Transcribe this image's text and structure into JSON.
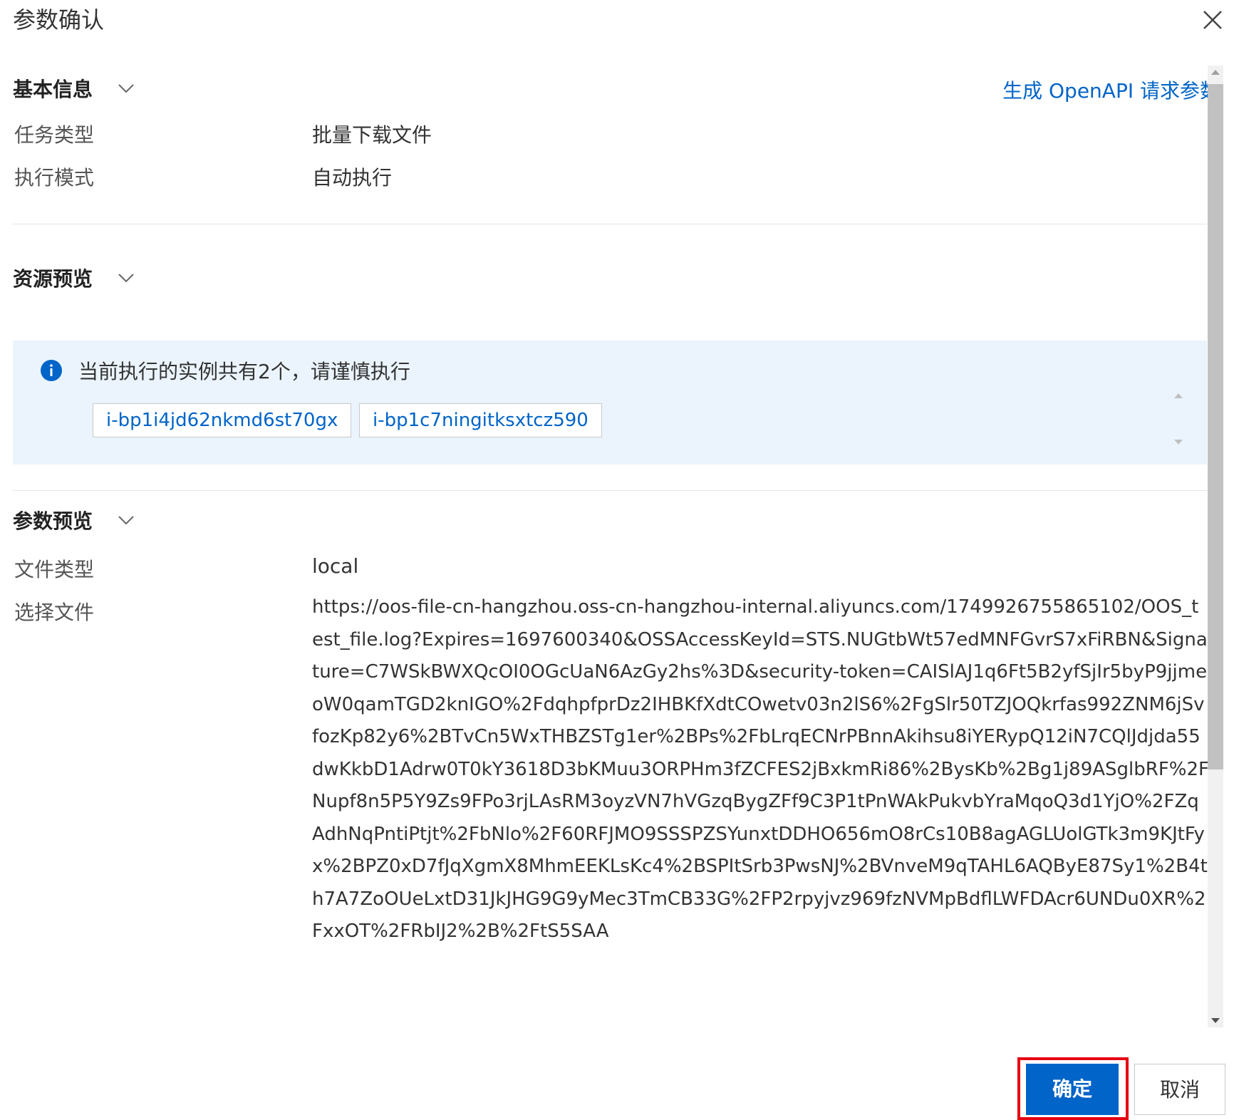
{
  "dialog": {
    "title": "参数确认",
    "close_icon": "close-icon"
  },
  "openapi_link": "生成 OpenAPI 请求参数",
  "basic_info": {
    "title": "基本信息",
    "rows": [
      {
        "label": "任务类型",
        "value": "批量下载文件"
      },
      {
        "label": "执行模式",
        "value": "自动执行"
      }
    ]
  },
  "resource_preview": {
    "title": "资源预览",
    "notice": "当前执行的实例共有2个，请谨慎执行",
    "instances": [
      "i-bp1i4jd62nkmd6st70gx",
      "i-bp1c7ningitksxtcz590"
    ]
  },
  "param_preview": {
    "title": "参数预览",
    "file_type_label": "文件类型",
    "file_type_value": "local",
    "select_file_label": "选择文件",
    "select_file_value": "https://oos-file-cn-hangzhou.oss-cn-hangzhou-internal.aliyuncs.com/1749926755865102/OOS_test_file.log?Expires=1697600340&OSSAccessKeyId=STS.NUGtbWt57edMNFGvrS7xFiRBN&Signature=C7WSkBWXQcOI0OGcUaN6AzGy2hs%3D&security-token=CAISlAJ1q6Ft5B2yfSjIr5byP9jjmeoW0qamTGD2knIGO%2FdqhpfprDz2IHBKfXdtCOwetv03n2lS6%2FgSlr50TZJOQkrfas992ZNM6jSvfozKp82y6%2BTvCn5WxTHBZSTg1er%2BPs%2FbLrqECNrPBnnAkihsu8iYERypQ12iN7CQlJdjda55dwKkbD1Adrw0T0kY3618D3bKMuu3ORPHm3fZCFES2jBxkmRi86%2BysKb%2Bg1j89ASglbRF%2FNupf8n5P5Y9Zs9FPo3rjLAsRM3oyzVN7hVGzqBygZFf9C3P1tPnWAkPukvbYraMqoQ3d1YjO%2FZqAdhNqPntiPtjt%2FbNlo%2F60RFJMO9SSSPZSYunxtDDHO656mO8rCs10B8agAGLUolGTk3m9KJtFyx%2BPZ0xD7fJqXgmX8MhmEEKLsKc4%2BSPItSrb3PwsNJ%2BVnveM9qTAHL6AQByE87Sy1%2B4th7A7ZoOUeLxtD31JkJHG9G9yMec3TmCB33G%2FP2rpyjvz969fzNVMpBdflLWFDAcr6UNDu0XR%2FxxOT%2FRbIJ2%2B%2FtS5SAA"
  },
  "footer": {
    "confirm": "确定",
    "cancel": "取消"
  },
  "colors": {
    "primary": "#0064c8",
    "info_bg": "#ebf4fd",
    "highlight": "#e60012"
  }
}
